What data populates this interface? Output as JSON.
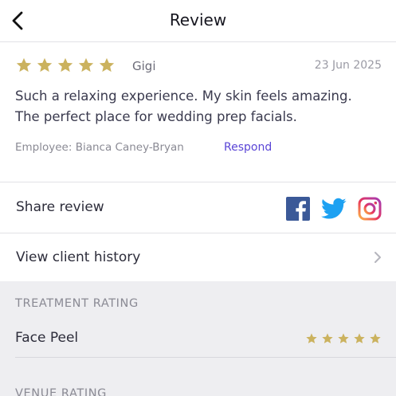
{
  "header": {
    "title": "Review",
    "back_icon": "chevron-left-icon"
  },
  "review": {
    "rating": 5,
    "reviewer": "Gigi",
    "date": "23 Jun 2025",
    "text_line1": "Such a relaxing experience. My skin feels amazing.",
    "text_line2": "The perfect place for wedding prep facials.",
    "employee": "Employee: Bianca Caney-Bryan",
    "respond_label": "Respond"
  },
  "share": {
    "label": "Share review",
    "icons": [
      "facebook-icon",
      "twitter-icon",
      "instagram-icon"
    ]
  },
  "client_history": {
    "label": "View client history"
  },
  "treatment_rating": {
    "title": "TREATMENT RATING",
    "items": [
      {
        "label": "Face Peel",
        "rating": 5
      }
    ]
  },
  "venue_rating": {
    "title": "VENUE RATING"
  },
  "colors": {
    "star": "#cbb25e",
    "accent": "#5a45d6",
    "facebook": "#3b5998",
    "twitter": "#1da1f2",
    "section_bg": "#eeeef1"
  }
}
